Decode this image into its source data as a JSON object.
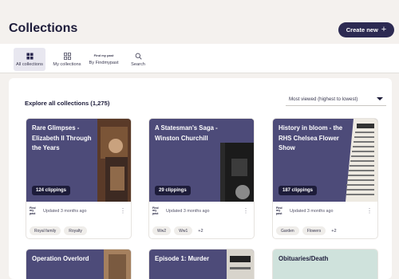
{
  "header": {
    "title": "Collections",
    "create_label": "Create new"
  },
  "tabs": [
    {
      "label": "All collections",
      "active": true
    },
    {
      "label": "My collections",
      "active": false
    },
    {
      "label": "By Findmypast",
      "logo": "Find my past",
      "active": false
    },
    {
      "label": "Search",
      "active": false
    }
  ],
  "main": {
    "heading": "Explore all collections (1,275)",
    "sort_value": "Most viewed (highest to lowest)"
  },
  "cards": [
    {
      "title": "Rare Glimpses - Elizabeth II Through the Years",
      "clippings": "124 clippings",
      "logo": "Find my past",
      "updated": "Updated 3 months ago",
      "tags": [
        "Royal family",
        "Royalty"
      ],
      "more": ""
    },
    {
      "title": "A Statesman's Saga - Winston Churchill",
      "clippings": "29 clippings",
      "logo": "Find my past",
      "updated": "Updated 3 months ago",
      "tags": [
        "Ww2",
        "Ww1"
      ],
      "more": "+2"
    },
    {
      "title": "History in bloom - the RHS Chelsea Flower Show",
      "clippings": "187 clippings",
      "logo": "Find my past",
      "updated": "Updated 3 months ago",
      "tags": [
        "Garden",
        "Flowers"
      ],
      "more": "+2"
    }
  ],
  "cards_row2": [
    {
      "title": "Operation Overlord"
    },
    {
      "title": "Episode 1: Murder"
    },
    {
      "title": "Obituaries/Death"
    }
  ],
  "colors": {
    "brand_navy": "#2c2a52",
    "card_purple": "#4d4b79",
    "page_bg": "#f4f1ee"
  }
}
